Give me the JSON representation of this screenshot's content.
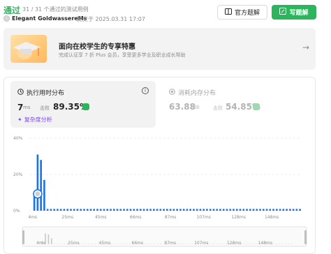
{
  "header": {
    "status": "通过",
    "passed_text": "31 / 31 个通过的测试用例",
    "username": "Elegant GoldwassereMs",
    "submitted_text": "提交于 2025.03.31 17:07",
    "official_solution_label": "官方题解",
    "write_solution_label": "写题解"
  },
  "banner": {
    "title": "面向在校学生的专享特惠",
    "subtitle": "完成认证享 7 折 Plus 会员，享受更多学业及职业成长帮助"
  },
  "runtime": {
    "title": "执行用时分布",
    "value": "7",
    "unit": "ms",
    "beat_label": "击败",
    "beat_pct": "89.35%",
    "complexity_label": "复杂度分析"
  },
  "memory": {
    "title": "消耗内存分布",
    "value": "63.88",
    "unit": "MB",
    "beat_label": "击败",
    "beat_pct": "54.85%"
  },
  "chart_data": {
    "type": "bar",
    "title": "",
    "xlabel": "",
    "ylabel": "",
    "ylim": [
      0,
      40
    ],
    "y_ticks": [
      "40%",
      "20%",
      "0%"
    ],
    "x_tick_labels": [
      "4ms",
      "25ms",
      "45ms",
      "66ms",
      "87ms",
      "107ms",
      "128ms",
      "148ms"
    ],
    "x_range": [
      2,
      166
    ],
    "bin_width_ms": 2,
    "bins_start_ms": 2,
    "values": [
      0,
      9,
      31,
      28,
      17,
      1,
      1,
      1,
      1,
      1,
      1,
      1,
      1,
      1,
      1,
      1,
      1,
      1,
      1,
      1,
      1,
      1,
      1,
      1,
      1,
      1,
      1,
      1,
      1,
      1,
      1,
      1,
      1,
      1,
      1,
      1,
      1,
      1,
      1,
      1,
      1,
      1,
      1,
      1,
      1,
      1,
      1,
      1,
      1,
      1,
      1,
      1,
      1,
      1,
      1,
      1,
      1,
      1,
      1,
      1,
      1,
      1,
      1,
      1,
      1,
      1,
      1,
      1,
      1,
      1,
      1,
      1,
      1,
      1,
      1,
      1,
      1,
      1,
      1,
      1,
      1,
      1
    ],
    "highlight_ms": 7,
    "colors": {
      "bar": "#1a73e8",
      "highlight": "#1a73e8",
      "grid": "#e6e6e6"
    }
  }
}
